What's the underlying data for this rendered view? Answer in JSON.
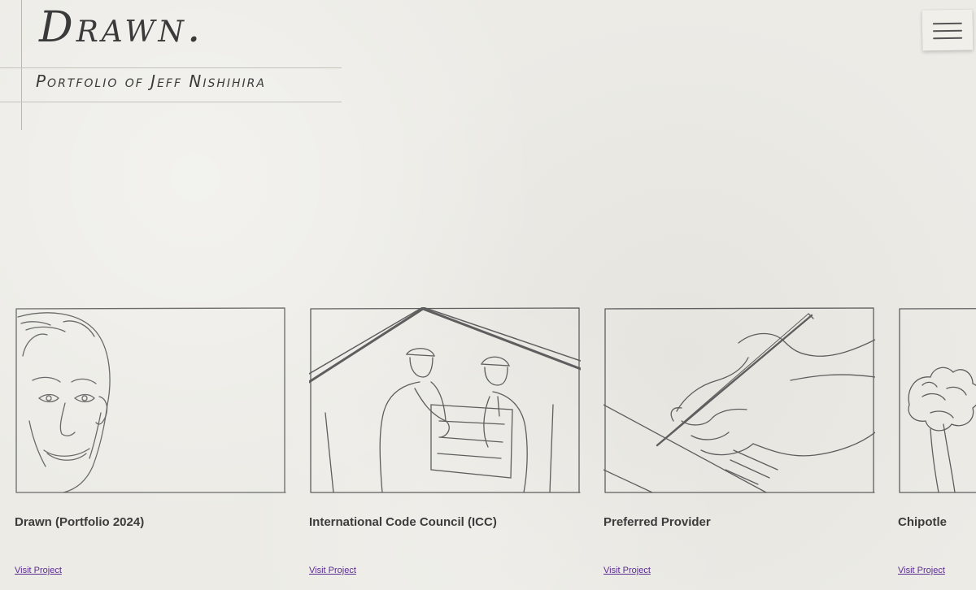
{
  "brand": {
    "logo": "Drawn.",
    "tagline": "Portfolio of Jeff Nishihira"
  },
  "menu": {
    "icon": "hamburger-menu-icon"
  },
  "projects": [
    {
      "title": "Drawn (Portfolio 2024)",
      "link_label": "Visit Project",
      "illustration": "sketch-portrait-face"
    },
    {
      "title": "International Code Council (ICC)",
      "link_label": "Visit Project",
      "illustration": "sketch-construction-workers"
    },
    {
      "title": "Preferred Provider",
      "link_label": "Visit Project",
      "illustration": "sketch-hand-writing"
    },
    {
      "title": "Chipotle",
      "link_label": "Visit Project",
      "illustration": "sketch-produce"
    }
  ],
  "colors": {
    "paper": "#ecebe6",
    "ink": "#3a3a3a",
    "link": "#5a2d91"
  }
}
